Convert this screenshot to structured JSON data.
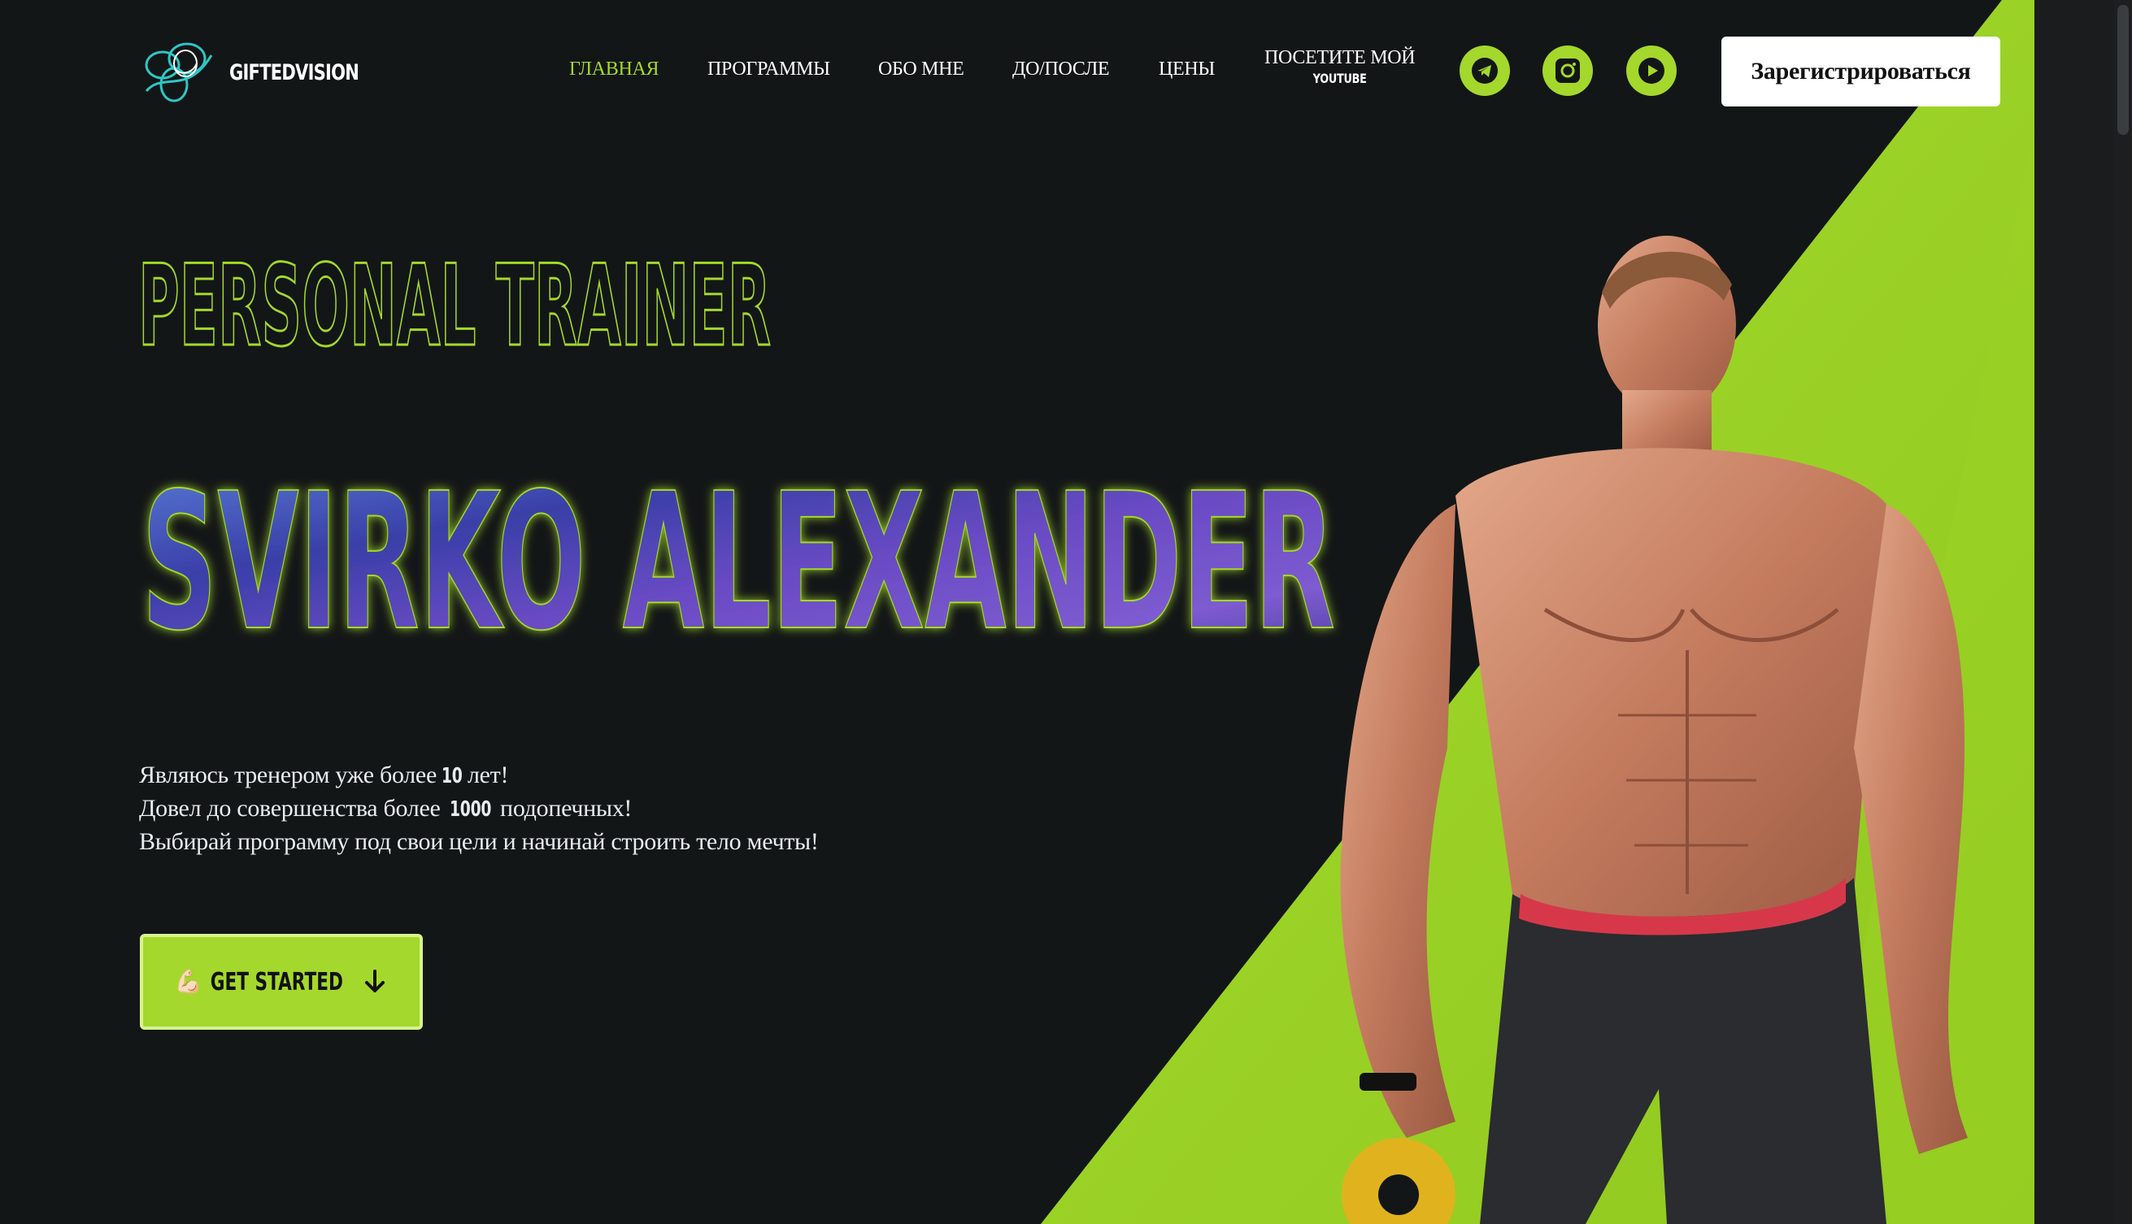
{
  "header": {
    "logo_text": "GIFTEDVISION",
    "nav": [
      {
        "label": "ГЛАВНАЯ",
        "active": true
      },
      {
        "label": "ПРОГРАММЫ"
      },
      {
        "label": "ОБО МНЕ"
      },
      {
        "label": "ДО/ПОСЛЕ"
      },
      {
        "label": "ЦЕНЫ"
      }
    ],
    "youtube_nav": {
      "line1": "ПОСЕТИТЕ МОЙ",
      "line2": "YOUTUBE"
    },
    "socials": [
      "telegram-icon",
      "instagram-icon",
      "youtube-icon"
    ],
    "register_label": "Зарегистрироваться"
  },
  "hero": {
    "subtitle": "PERSONAL TRAINER",
    "name": "SVIRKO ALEXANDER",
    "about_lines": [
      {
        "pre": "Являюсь тренером уже более ",
        "num": "10",
        "post": " лет!"
      },
      {
        "pre": "Довел до совершенства более ",
        "num": "1000",
        "post": " подопечных!"
      },
      {
        "pre": "Выбирай программу под свои цели и начинай строить тело мечты!",
        "num": "",
        "post": ""
      }
    ],
    "cta_emoji": "💪🏻",
    "cta_label": "GET STARTED"
  },
  "colors": {
    "accent": "#a4d82c",
    "background": "#131617",
    "button_bg": "#ffffff"
  }
}
